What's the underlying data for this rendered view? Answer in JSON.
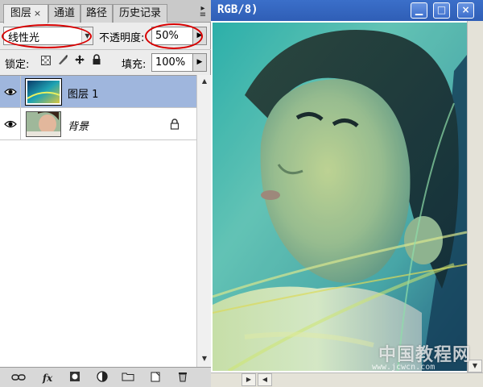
{
  "layers_panel": {
    "tabs": [
      {
        "label": "图层"
      },
      {
        "label": "通道"
      },
      {
        "label": "路径"
      },
      {
        "label": "历史记录"
      }
    ],
    "tab_close": "×",
    "menu_icon": "panel-menu-icon",
    "blend_mode": "线性光",
    "opacity_label": "不透明度:",
    "opacity_value": "50%",
    "lock_label": "锁定:",
    "fill_label": "填充:",
    "fill_value": "100%",
    "layers": [
      {
        "name": "图层 1",
        "selected": true,
        "visible": true,
        "locked": false
      },
      {
        "name": "背景",
        "selected": false,
        "visible": true,
        "locked": true
      }
    ],
    "footer_icons": [
      "link-layers-icon",
      "layer-style-fx-icon",
      "add-mask-icon",
      "adjustment-layer-icon",
      "new-group-icon",
      "new-layer-icon",
      "delete-layer-icon"
    ],
    "footer_fx": "fx"
  },
  "document": {
    "title": "RGB/8)",
    "minimize": "▁",
    "maximize": "□",
    "close": "×"
  },
  "watermark": {
    "text": "中国教程网",
    "url": "www.jcwcn.com"
  },
  "colors": {
    "selection_highlight": "#9fb6dd",
    "annotation_red": "#d80000",
    "titlebar_blue": "#2f5eb6"
  }
}
